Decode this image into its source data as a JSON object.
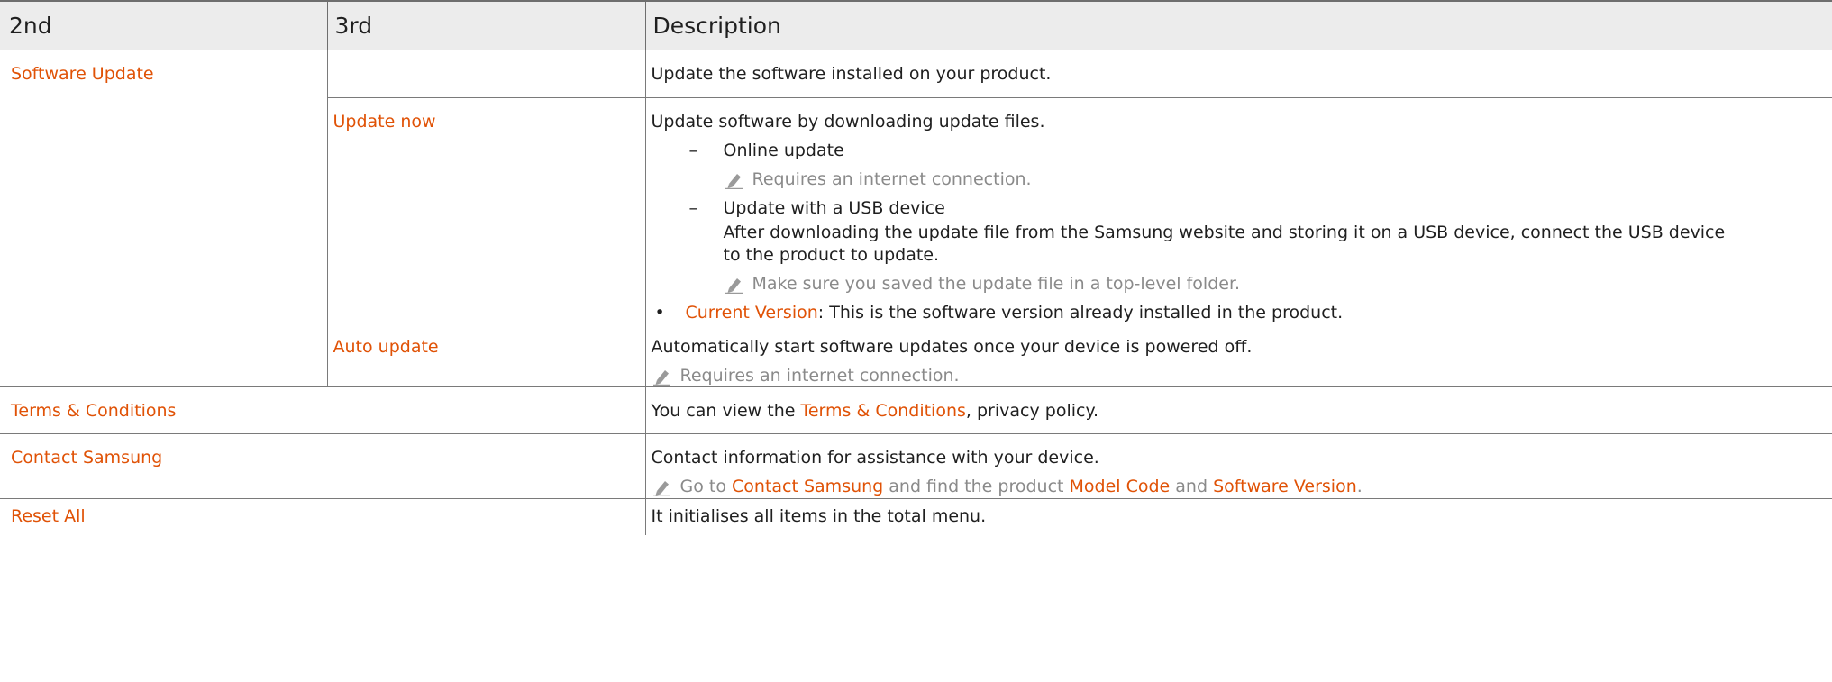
{
  "header": {
    "col1": "2nd",
    "col2": "3rd",
    "col3": "Description"
  },
  "rows": {
    "software_update": {
      "label": "Software Update",
      "description": "Update the software installed on your product."
    },
    "update_now": {
      "label": "Update now",
      "description": "Update software by downloading update files.",
      "online_update": "Online update",
      "online_note": "Requires an internet connection.",
      "usb_update": "Update with a USB device",
      "usb_text_1": "After downloading the update file from the Samsung website and storing it on a USB device, connect the USB device",
      "usb_text_2": "to the product to update.",
      "usb_note": "Make sure you saved the update file in a top-level folder.",
      "current_version_label": "Current Version",
      "current_version_text": ": This is the software version already installed in the product."
    },
    "auto_update": {
      "label": "Auto update",
      "description": "Automatically start software updates once your device is powered off.",
      "note": "Requires an internet connection."
    },
    "terms": {
      "label": "Terms & Conditions",
      "desc_prefix": "You can view the ",
      "desc_link": "Terms & Conditions",
      "desc_suffix": ", privacy policy."
    },
    "contact": {
      "label": "Contact Samsung",
      "description": "Contact information for assistance with your device.",
      "note_prefix": "Go to ",
      "note_link1": "Contact Samsung",
      "note_mid1": " and find the product ",
      "note_link2": "Model Code",
      "note_mid2": " and ",
      "note_link3": "Software Version",
      "note_suffix": "."
    },
    "reset": {
      "label": "Reset All",
      "description": "It initialises all items in the total menu."
    }
  },
  "icons": {
    "note_icon": "pencil-icon"
  },
  "colors": {
    "accent": "#e05206",
    "note": "#8a8a8a",
    "header_bg": "#ececec"
  }
}
